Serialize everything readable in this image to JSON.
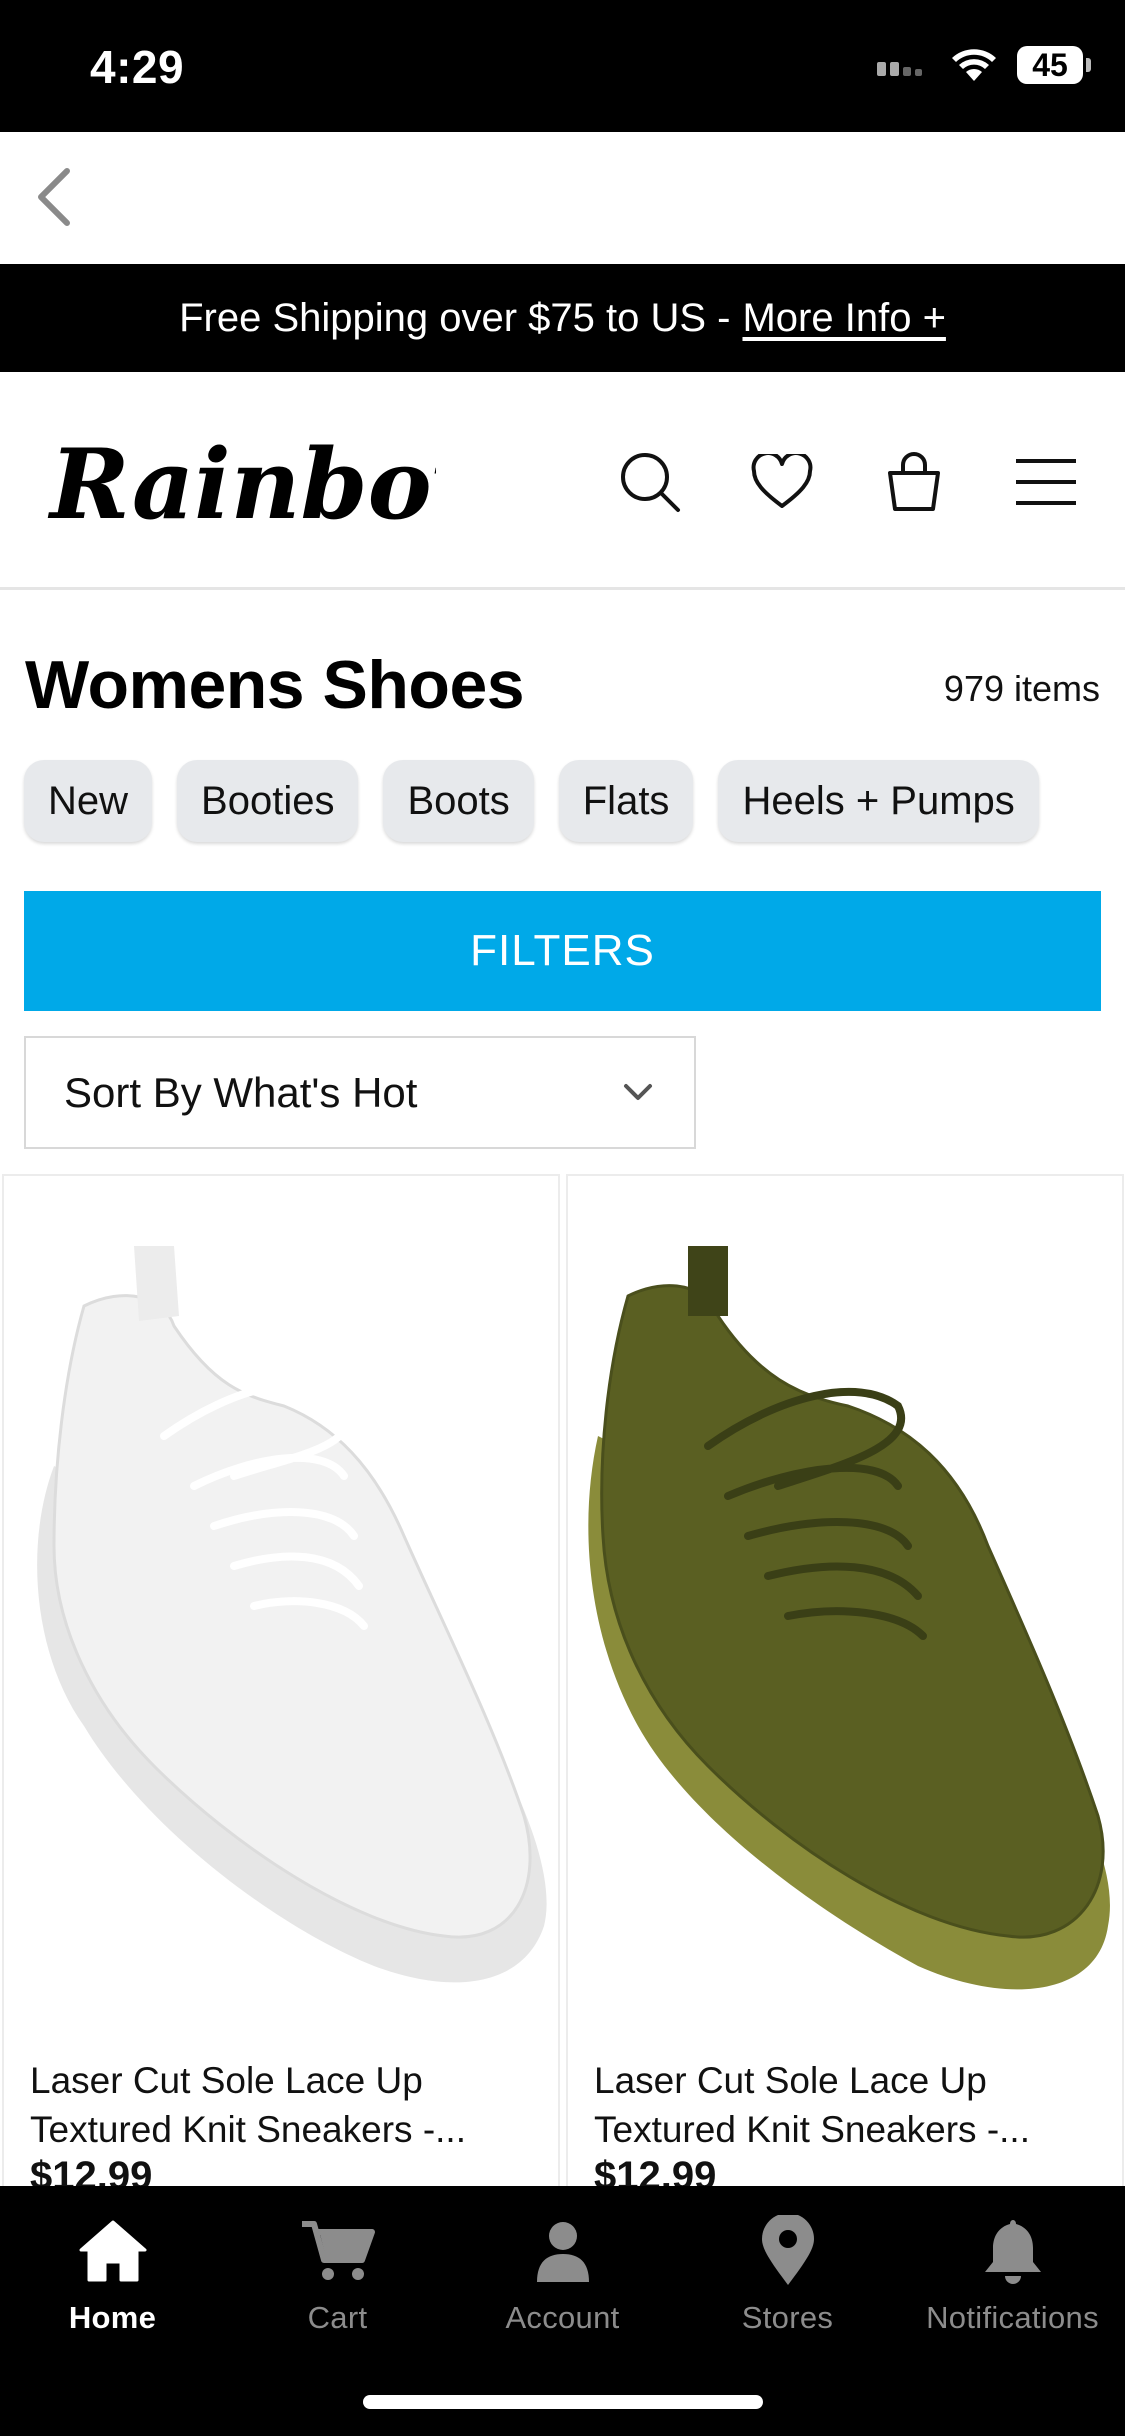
{
  "status_bar": {
    "time": "4:29",
    "battery": "45"
  },
  "promo": {
    "text": "Free Shipping over $75 to US -",
    "link": "More Info +"
  },
  "header": {
    "logo_text": "Rainbow"
  },
  "page": {
    "title": "Womens Shoes",
    "item_count": "979 items"
  },
  "chips": [
    "New",
    "Booties",
    "Boots",
    "Flats",
    "Heels + Pumps"
  ],
  "filters": {
    "label": "FILTERS"
  },
  "sort": {
    "selected": "Sort By What's Hot"
  },
  "products": [
    {
      "name_line1": "Laser Cut Sole Lace Up",
      "name_line2": "Textured Knit Sneakers -...",
      "price": "$12.99",
      "color": "#f2f2f2"
    },
    {
      "name_line1": "Laser Cut Sole Lace Up",
      "name_line2": "Textured Knit Sneakers -...",
      "price": "$12.99",
      "color": "#5a5f22"
    }
  ],
  "tabs": [
    {
      "label": "Home",
      "icon": "home-icon",
      "active": true
    },
    {
      "label": "Cart",
      "icon": "cart-icon",
      "active": false
    },
    {
      "label": "Account",
      "icon": "account-icon",
      "active": false
    },
    {
      "label": "Stores",
      "icon": "location-pin-icon",
      "active": false
    },
    {
      "label": "Notifications",
      "icon": "bell-icon",
      "active": false
    }
  ],
  "colors": {
    "accent": "#00a9e8",
    "banner": "#000000",
    "chip_bg": "#e7e9ec"
  }
}
